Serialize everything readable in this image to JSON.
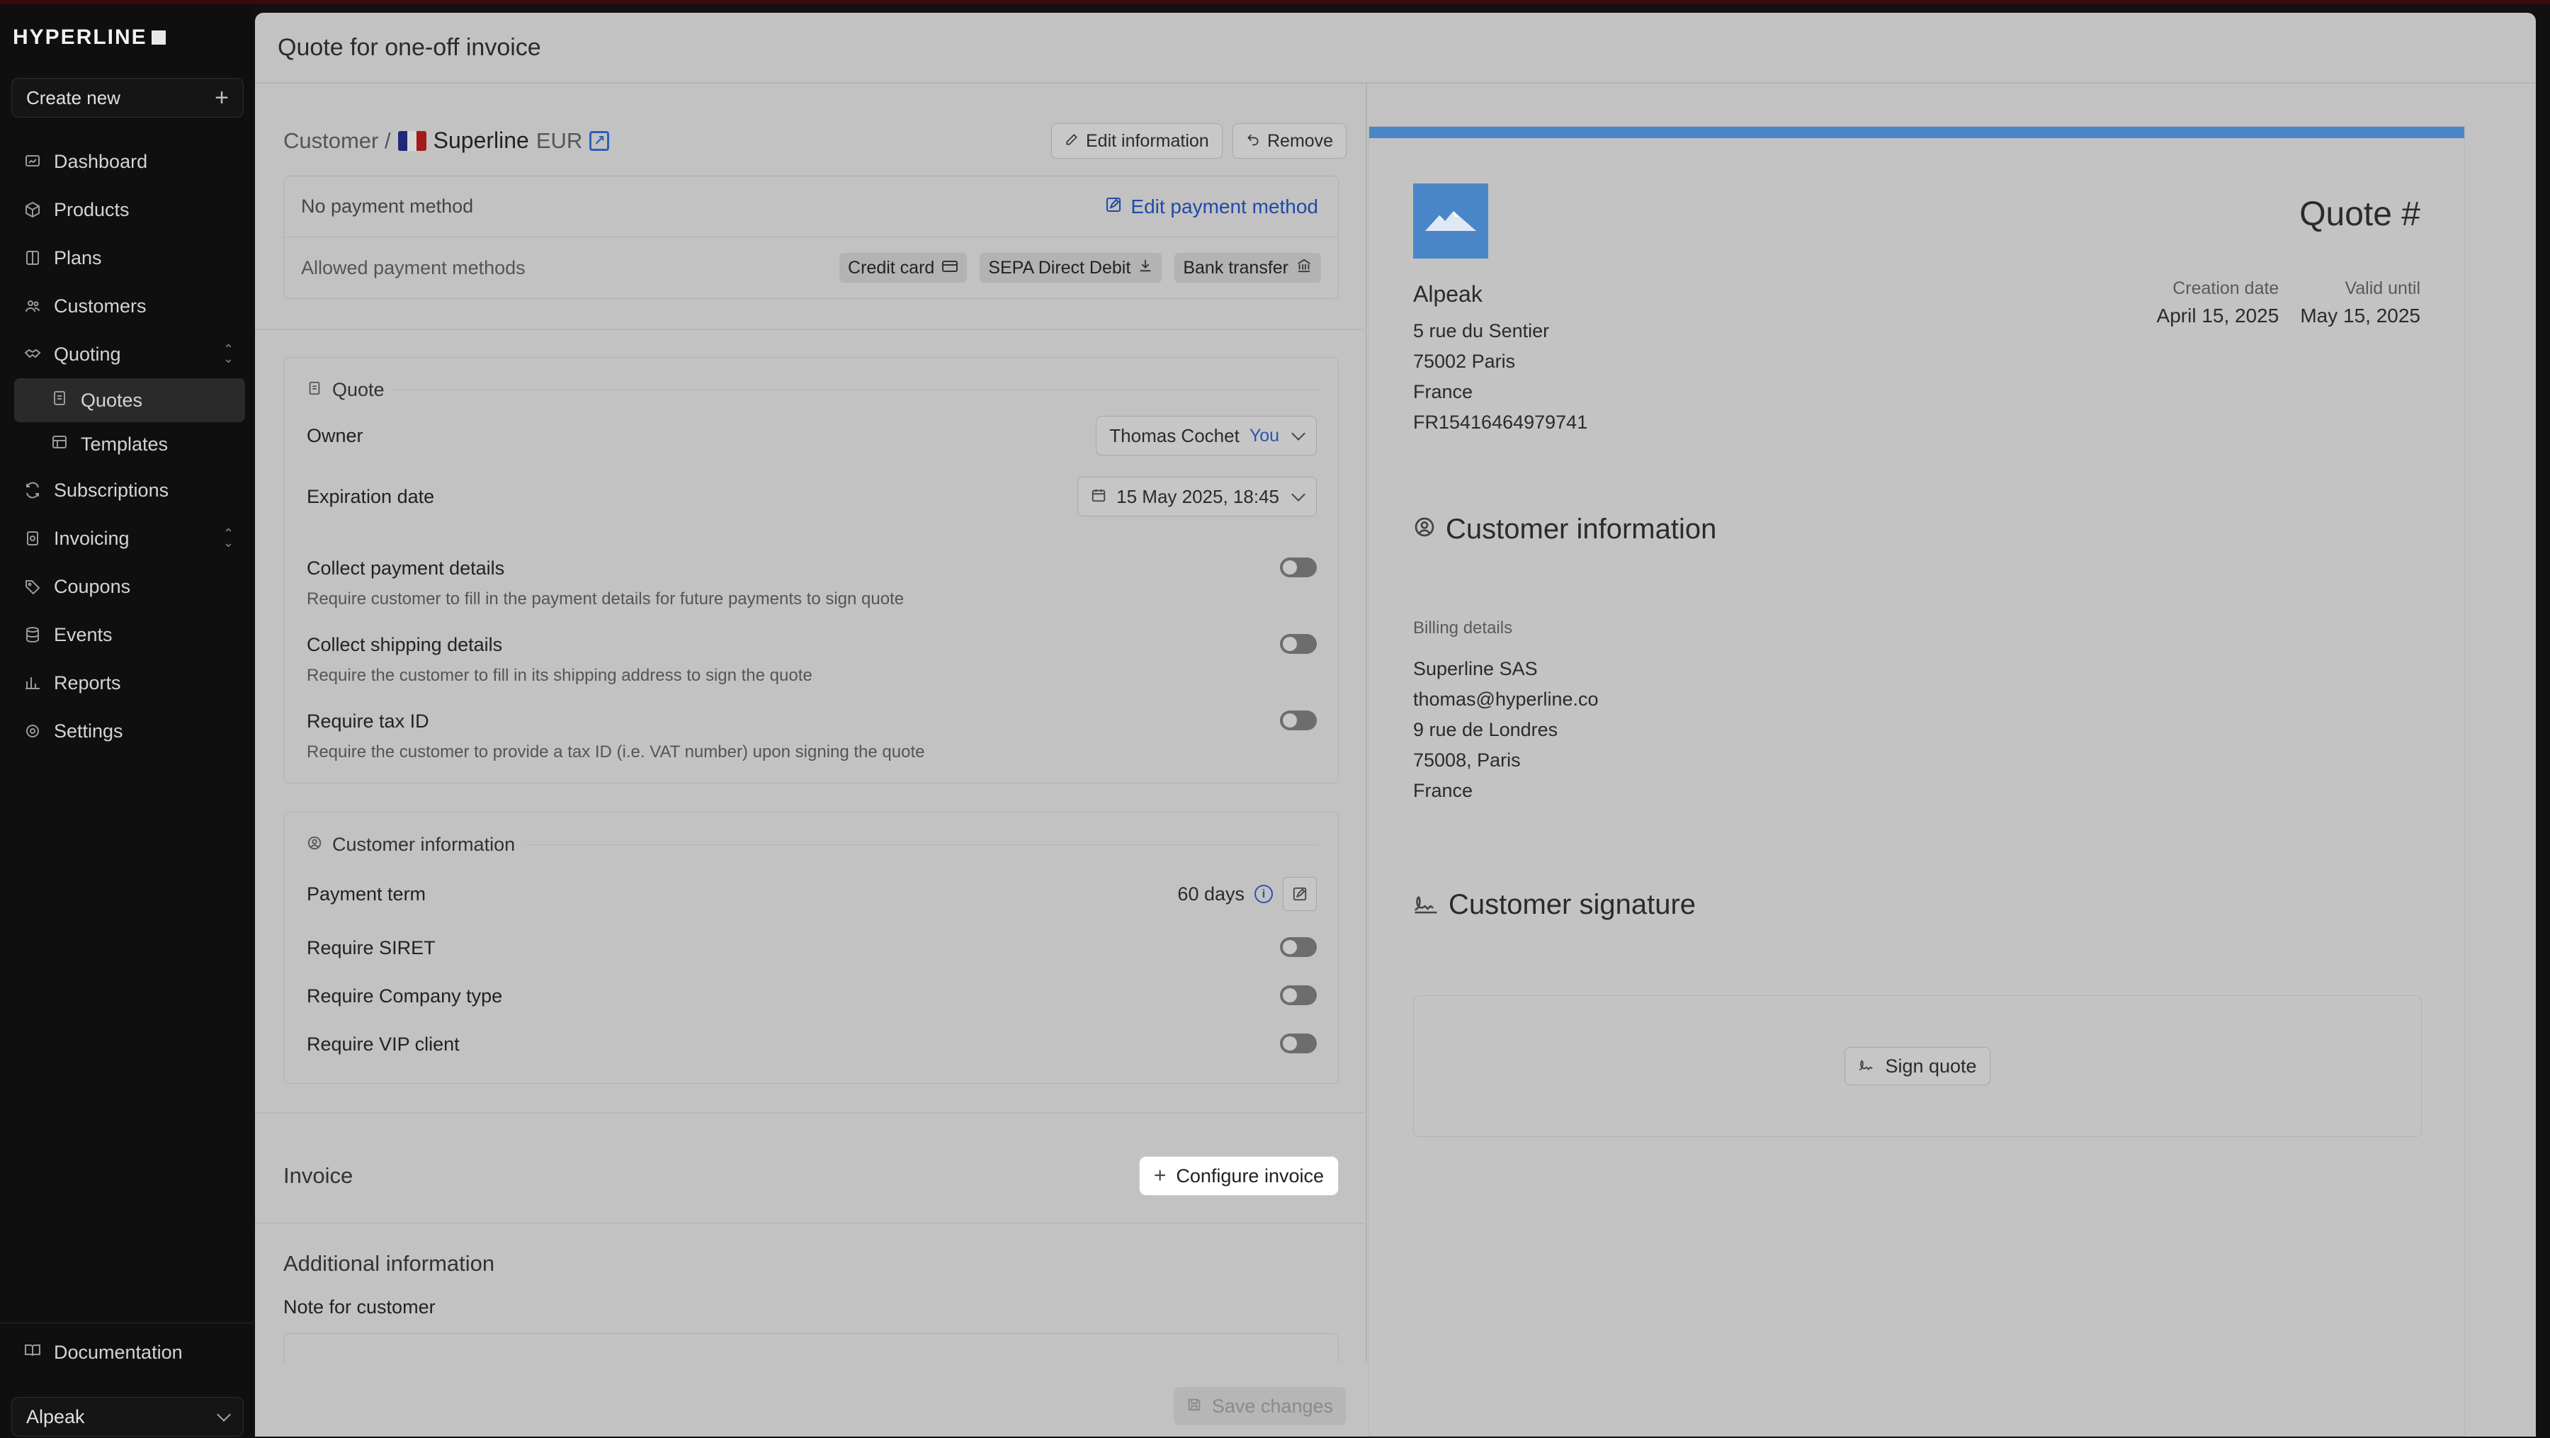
{
  "app": {
    "logo_text": "HYPERLINE"
  },
  "sidebar": {
    "create_new": "Create new",
    "items": [
      {
        "label": "Dashboard",
        "icon": "dashboard-icon"
      },
      {
        "label": "Products",
        "icon": "box-icon"
      },
      {
        "label": "Plans",
        "icon": "plans-icon"
      },
      {
        "label": "Customers",
        "icon": "users-icon"
      },
      {
        "label": "Quoting",
        "icon": "handshake-icon",
        "expanded": true
      },
      {
        "label": "Quotes",
        "icon": "file-icon",
        "active": true
      },
      {
        "label": "Templates",
        "icon": "layout-icon"
      },
      {
        "label": "Subscriptions",
        "icon": "refresh-icon"
      },
      {
        "label": "Invoicing",
        "icon": "invoice-icon",
        "expanded": false
      },
      {
        "label": "Coupons",
        "icon": "tag-icon"
      },
      {
        "label": "Events",
        "icon": "database-icon"
      },
      {
        "label": "Reports",
        "icon": "chart-icon"
      },
      {
        "label": "Settings",
        "icon": "gear-icon"
      }
    ],
    "documentation": "Documentation",
    "org": "Alpeak"
  },
  "modal": {
    "title": "Quote for one-off invoice",
    "customer": {
      "prefix": "Customer /",
      "name": "Superline",
      "currency": "EUR",
      "edit_info": "Edit information",
      "remove": "Remove"
    },
    "payment": {
      "no_method": "No payment method",
      "edit_method": "Edit payment method",
      "allowed_label": "Allowed payment methods",
      "methods": [
        "Credit card",
        "SEPA Direct Debit",
        "Bank transfer"
      ]
    },
    "quote": {
      "title": "Quote",
      "owner_label": "Owner",
      "owner_value": "Thomas Cochet",
      "owner_badge": "You",
      "expiration_label": "Expiration date",
      "expiration_value": "15 May 2025, 18:45",
      "collect_payment": "Collect payment details",
      "collect_payment_sub": "Require customer to fill in the payment details for future payments to sign quote",
      "collect_shipping": "Collect shipping details",
      "collect_shipping_sub": "Require the customer to fill in its shipping address to sign the quote",
      "tax_id": "Require tax ID",
      "tax_id_sub": "Require the customer to provide a tax ID (i.e. VAT number) upon signing the quote"
    },
    "customer_info": {
      "title": "Customer information",
      "payment_term_label": "Payment term",
      "payment_term_value": "60 days",
      "siret": "Require SIRET",
      "company_type": "Require Company type",
      "vip": "Require VIP client"
    },
    "invoice": {
      "title": "Invoice",
      "configure": "Configure invoice"
    },
    "additional": {
      "title": "Additional information",
      "note_label": "Note for customer"
    },
    "save": "Save changes"
  },
  "preview": {
    "title": "Quote #",
    "company": {
      "name": "Alpeak",
      "address1": "5 rue du Sentier",
      "address2": "75002 Paris",
      "country": "France",
      "vat": "FR15416464979741"
    },
    "creation_label": "Creation date",
    "creation_value": "April 15, 2025",
    "valid_label": "Valid until",
    "valid_value": "May 15, 2025",
    "customer_info_title": "Customer information",
    "billing_label": "Billing details",
    "billing": {
      "name": "Superline SAS",
      "email": "thomas@hyperline.co",
      "address": "9 rue de Londres",
      "city": "75008, Paris",
      "country": "France"
    },
    "signature_title": "Customer signature",
    "sign_button": "Sign quote"
  },
  "colors": {
    "accent": "#4a86c7",
    "link": "#1f4aa8",
    "sidebar_bg": "#0f0f0f",
    "overlay_bg": "#c2c2c2"
  }
}
